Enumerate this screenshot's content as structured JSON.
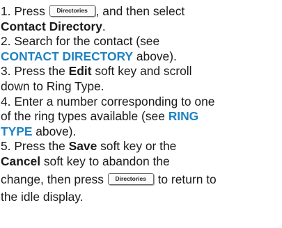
{
  "steps": {
    "s1": {
      "prefix": "1. Press ",
      "key_label": "Directories",
      "suffix": ", and then select",
      "bold": "Contact Directory",
      "end": "."
    },
    "s2": {
      "line1": "2. Search for the contact (see",
      "link": "CONTACT DIRECTORY",
      "end": " above)."
    },
    "s3": {
      "prefix": "3. Press the ",
      "bold": "Edit",
      "suffix": " soft key and scroll",
      "line2": "down to Ring Type."
    },
    "s4": {
      "line1": "4. Enter a number corresponding to one",
      "line2_prefix": "of the ring types available (see ",
      "link_part1": "RING",
      "link_part2": "TYPE",
      "end": " above)."
    },
    "s5": {
      "prefix": "5. Press the ",
      "bold1": "Save",
      "suffix1": " soft key or the",
      "bold2": "Cancel",
      "suffix2": " soft key to abandon the",
      "line3_prefix": "change, then press ",
      "key_label": "Directories",
      "line3_suffix": " to return to",
      "line4": "the idle display."
    }
  }
}
